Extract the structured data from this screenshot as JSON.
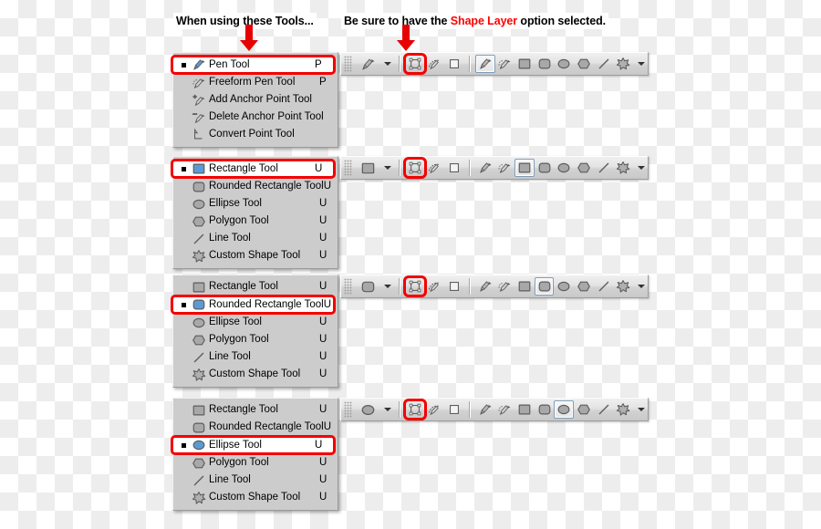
{
  "header": {
    "left_caption": "When using these Tools...",
    "right_caption_pre": "Be sure to have the ",
    "right_caption_highlight": "Shape Layer",
    "right_caption_post": " option selected.",
    "highlight_color": "#ff0000",
    "arrow_color": "#e60000",
    "arrow_left_name": "red-down-arrow-tools",
    "arrow_right_name": "red-down-arrow-shape-layer"
  },
  "groups": [
    {
      "id": "pen-group",
      "selected_tool": "Pen Tool",
      "menu": [
        {
          "label": "Pen Tool",
          "key": "P",
          "icon": "pen-tool-icon",
          "selected": true
        },
        {
          "label": "Freeform Pen Tool",
          "key": "P",
          "icon": "freeform-pen-tool-icon",
          "selected": false
        },
        {
          "label": "Add Anchor Point Tool",
          "key": "",
          "icon": "add-anchor-point-tool-icon",
          "selected": false
        },
        {
          "label": "Delete Anchor Point Tool",
          "key": "",
          "icon": "delete-anchor-point-tool-icon",
          "selected": false
        },
        {
          "label": "Convert Point Tool",
          "key": "",
          "icon": "convert-point-tool-icon",
          "selected": false
        }
      ],
      "optionsbar": {
        "preview_icon": "pen-tool-icon",
        "mode_buttons": [
          {
            "icon": "shape-layers-icon",
            "name": "shape-layers-button",
            "active": false,
            "ringed": true
          },
          {
            "icon": "paths-icon",
            "name": "paths-button",
            "active": false,
            "ringed": false
          },
          {
            "icon": "fill-pixels-icon",
            "name": "fill-pixels-button",
            "active": false,
            "ringed": false
          }
        ],
        "tool_buttons": [
          {
            "icon": "pen-tool-icon",
            "name": "pen-tool-button",
            "active": true
          },
          {
            "icon": "freeform-pen-tool-icon",
            "name": "freeform-pen-tool-button",
            "active": false
          },
          {
            "icon": "rectangle-tool-icon",
            "name": "rectangle-tool-button",
            "active": false
          },
          {
            "icon": "rounded-rectangle-icon",
            "name": "rounded-rectangle-button",
            "active": false
          },
          {
            "icon": "ellipse-tool-icon",
            "name": "ellipse-tool-button",
            "active": false
          },
          {
            "icon": "polygon-tool-icon",
            "name": "polygon-tool-button",
            "active": false
          },
          {
            "icon": "line-tool-icon",
            "name": "line-tool-button",
            "active": false
          },
          {
            "icon": "custom-shape-tool-icon",
            "name": "custom-shape-tool-button",
            "active": false
          }
        ]
      }
    },
    {
      "id": "rectangle-group",
      "selected_tool": "Rectangle Tool",
      "menu": [
        {
          "label": "Rectangle Tool",
          "key": "U",
          "icon": "rectangle-tool-icon",
          "selected": true
        },
        {
          "label": "Rounded Rectangle Tool",
          "key": "U",
          "icon": "rounded-rectangle-icon",
          "selected": false
        },
        {
          "label": "Ellipse Tool",
          "key": "U",
          "icon": "ellipse-tool-icon",
          "selected": false
        },
        {
          "label": "Polygon Tool",
          "key": "U",
          "icon": "polygon-tool-icon",
          "selected": false
        },
        {
          "label": "Line Tool",
          "key": "U",
          "icon": "line-tool-icon",
          "selected": false
        },
        {
          "label": "Custom Shape Tool",
          "key": "U",
          "icon": "custom-shape-tool-icon",
          "selected": false
        }
      ],
      "optionsbar": {
        "preview_icon": "rectangle-tool-icon",
        "mode_buttons": [
          {
            "icon": "shape-layers-icon",
            "name": "shape-layers-button",
            "active": false,
            "ringed": true
          },
          {
            "icon": "paths-icon",
            "name": "paths-button",
            "active": false,
            "ringed": false
          },
          {
            "icon": "fill-pixels-icon",
            "name": "fill-pixels-button",
            "active": false,
            "ringed": false
          }
        ],
        "tool_buttons": [
          {
            "icon": "pen-tool-icon",
            "name": "pen-tool-button",
            "active": false
          },
          {
            "icon": "freeform-pen-tool-icon",
            "name": "freeform-pen-tool-button",
            "active": false
          },
          {
            "icon": "rectangle-tool-icon",
            "name": "rectangle-tool-button",
            "active": true
          },
          {
            "icon": "rounded-rectangle-icon",
            "name": "rounded-rectangle-button",
            "active": false
          },
          {
            "icon": "ellipse-tool-icon",
            "name": "ellipse-tool-button",
            "active": false
          },
          {
            "icon": "polygon-tool-icon",
            "name": "polygon-tool-button",
            "active": false
          },
          {
            "icon": "line-tool-icon",
            "name": "line-tool-button",
            "active": false
          },
          {
            "icon": "custom-shape-tool-icon",
            "name": "custom-shape-tool-button",
            "active": false
          }
        ]
      }
    },
    {
      "id": "rounded-rectangle-group",
      "selected_tool": "Rounded Rectangle Tool",
      "menu": [
        {
          "label": "Rectangle Tool",
          "key": "U",
          "icon": "rectangle-tool-icon",
          "selected": false
        },
        {
          "label": "Rounded Rectangle Tool",
          "key": "U",
          "icon": "rounded-rectangle-icon",
          "selected": true
        },
        {
          "label": "Ellipse Tool",
          "key": "U",
          "icon": "ellipse-tool-icon",
          "selected": false
        },
        {
          "label": "Polygon Tool",
          "key": "U",
          "icon": "polygon-tool-icon",
          "selected": false
        },
        {
          "label": "Line Tool",
          "key": "U",
          "icon": "line-tool-icon",
          "selected": false
        },
        {
          "label": "Custom Shape Tool",
          "key": "U",
          "icon": "custom-shape-tool-icon",
          "selected": false
        }
      ],
      "optionsbar": {
        "preview_icon": "rounded-rectangle-icon",
        "mode_buttons": [
          {
            "icon": "shape-layers-icon",
            "name": "shape-layers-button",
            "active": false,
            "ringed": true
          },
          {
            "icon": "paths-icon",
            "name": "paths-button",
            "active": false,
            "ringed": false
          },
          {
            "icon": "fill-pixels-icon",
            "name": "fill-pixels-button",
            "active": false,
            "ringed": false
          }
        ],
        "tool_buttons": [
          {
            "icon": "pen-tool-icon",
            "name": "pen-tool-button",
            "active": false
          },
          {
            "icon": "freeform-pen-tool-icon",
            "name": "freeform-pen-tool-button",
            "active": false
          },
          {
            "icon": "rectangle-tool-icon",
            "name": "rectangle-tool-button",
            "active": false
          },
          {
            "icon": "rounded-rectangle-icon",
            "name": "rounded-rectangle-button",
            "active": true
          },
          {
            "icon": "ellipse-tool-icon",
            "name": "ellipse-tool-button",
            "active": false
          },
          {
            "icon": "polygon-tool-icon",
            "name": "polygon-tool-button",
            "active": false
          },
          {
            "icon": "line-tool-icon",
            "name": "line-tool-button",
            "active": false
          },
          {
            "icon": "custom-shape-tool-icon",
            "name": "custom-shape-tool-button",
            "active": false
          }
        ]
      }
    },
    {
      "id": "ellipse-group",
      "selected_tool": "Ellipse Tool",
      "menu": [
        {
          "label": "Rectangle Tool",
          "key": "U",
          "icon": "rectangle-tool-icon",
          "selected": false
        },
        {
          "label": "Rounded Rectangle Tool",
          "key": "U",
          "icon": "rounded-rectangle-icon",
          "selected": false
        },
        {
          "label": "Ellipse Tool",
          "key": "U",
          "icon": "ellipse-tool-icon",
          "selected": true
        },
        {
          "label": "Polygon Tool",
          "key": "U",
          "icon": "polygon-tool-icon",
          "selected": false
        },
        {
          "label": "Line Tool",
          "key": "U",
          "icon": "line-tool-icon",
          "selected": false
        },
        {
          "label": "Custom Shape Tool",
          "key": "U",
          "icon": "custom-shape-tool-icon",
          "selected": false
        }
      ],
      "optionsbar": {
        "preview_icon": "ellipse-tool-icon",
        "mode_buttons": [
          {
            "icon": "shape-layers-icon",
            "name": "shape-layers-button",
            "active": false,
            "ringed": true
          },
          {
            "icon": "paths-icon",
            "name": "paths-button",
            "active": false,
            "ringed": false
          },
          {
            "icon": "fill-pixels-icon",
            "name": "fill-pixels-button",
            "active": false,
            "ringed": false
          }
        ],
        "tool_buttons": [
          {
            "icon": "pen-tool-icon",
            "name": "pen-tool-button",
            "active": false
          },
          {
            "icon": "freeform-pen-tool-icon",
            "name": "freeform-pen-tool-button",
            "active": false
          },
          {
            "icon": "rectangle-tool-icon",
            "name": "rectangle-tool-button",
            "active": false
          },
          {
            "icon": "rounded-rectangle-icon",
            "name": "rounded-rectangle-button",
            "active": false
          },
          {
            "icon": "ellipse-tool-icon",
            "name": "ellipse-tool-button",
            "active": true
          },
          {
            "icon": "polygon-tool-icon",
            "name": "polygon-tool-button",
            "active": false
          },
          {
            "icon": "line-tool-icon",
            "name": "line-tool-button",
            "active": false
          },
          {
            "icon": "custom-shape-tool-icon",
            "name": "custom-shape-tool-button",
            "active": false
          }
        ]
      }
    }
  ]
}
